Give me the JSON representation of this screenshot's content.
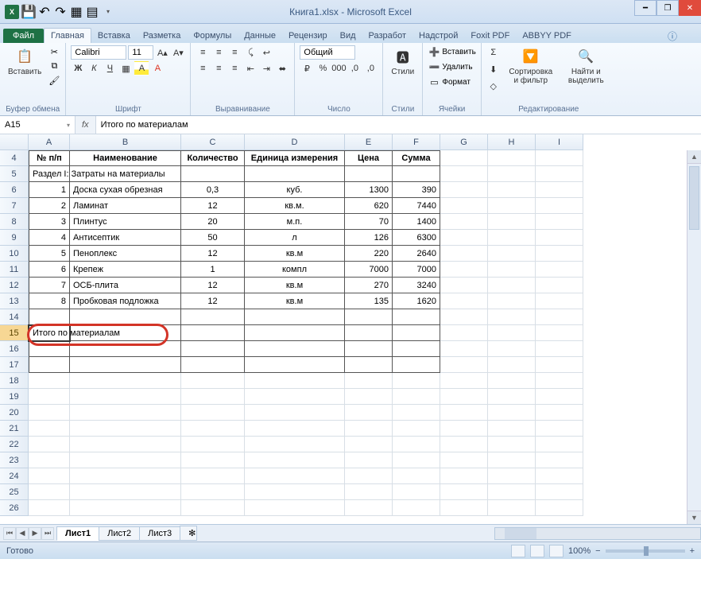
{
  "title": "Книга1.xlsx - Microsoft Excel",
  "ribbon_tabs": {
    "file": "Файл",
    "home": "Главная",
    "insert": "Вставка",
    "layout": "Разметка",
    "formulas": "Формулы",
    "data": "Данные",
    "review": "Рецензир",
    "view": "Вид",
    "developer": "Разработ",
    "addins": "Надстрой",
    "foxit": "Foxit PDF",
    "abbyy": "ABBYY PDF"
  },
  "ribbon": {
    "clipboard": {
      "paste": "Вставить",
      "label": "Буфер обмена"
    },
    "font": {
      "name": "Calibri",
      "size": "11",
      "label": "Шрифт"
    },
    "alignment": {
      "label": "Выравнивание"
    },
    "number": {
      "format": "Общий",
      "label": "Число"
    },
    "styles": {
      "btn": "Стили",
      "label": "Стили"
    },
    "cells": {
      "insert": "Вставить",
      "delete": "Удалить",
      "format": "Формат",
      "label": "Ячейки"
    },
    "editing": {
      "sort": "Сортировка и фильтр",
      "find": "Найти и выделить",
      "label": "Редактирование"
    }
  },
  "namebox": "A15",
  "formula_bar": "Итого по материалам",
  "columns": [
    "A",
    "B",
    "C",
    "D",
    "E",
    "F",
    "G",
    "H",
    "I"
  ],
  "row_start": 4,
  "headers": {
    "A": "№ п/п",
    "B": "Наименование",
    "C": "Количество",
    "D": "Единица измерения",
    "E": "Цена",
    "F": "Сумма"
  },
  "section": "Раздел I: Затраты на материалы",
  "rows": [
    {
      "n": "1",
      "name": "Доска сухая обрезная",
      "qty": "0,3",
      "unit": "куб.",
      "price": "1300",
      "sum": "390"
    },
    {
      "n": "2",
      "name": "Ламинат",
      "qty": "12",
      "unit": "кв.м.",
      "price": "620",
      "sum": "7440"
    },
    {
      "n": "3",
      "name": "Плинтус",
      "qty": "20",
      "unit": "м.п.",
      "price": "70",
      "sum": "1400"
    },
    {
      "n": "4",
      "name": "Антисептик",
      "qty": "50",
      "unit": "л",
      "price": "126",
      "sum": "6300"
    },
    {
      "n": "5",
      "name": "Пеноплекс",
      "qty": "12",
      "unit": "кв.м",
      "price": "220",
      "sum": "2640"
    },
    {
      "n": "6",
      "name": "Крепеж",
      "qty": "1",
      "unit": "компл",
      "price": "7000",
      "sum": "7000"
    },
    {
      "n": "7",
      "name": "ОСБ-плита",
      "qty": "12",
      "unit": "кв.м",
      "price": "270",
      "sum": "3240"
    },
    {
      "n": "8",
      "name": "Пробковая подложка",
      "qty": "12",
      "unit": "кв.м",
      "price": "135",
      "sum": "1620"
    }
  ],
  "total_label": "Итого по материалам",
  "sheets": {
    "s1": "Лист1",
    "s2": "Лист2",
    "s3": "Лист3"
  },
  "status": "Готово",
  "zoom": "100%"
}
